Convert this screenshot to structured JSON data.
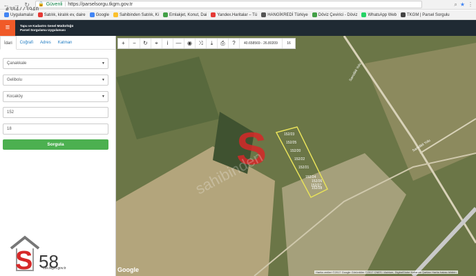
{
  "browser": {
    "secure_label": "Güvenli",
    "url": "https://parselsorgu.tkgm.gov.tr"
  },
  "overlay": {
    "tag": "#384//3940"
  },
  "bookmarks": [
    {
      "label": "Uygulamalar",
      "color": "#4285f4"
    },
    {
      "label": "Satılık, kiralık ev, daire",
      "color": "#e53935"
    },
    {
      "label": "Google",
      "color": "#4285f4"
    },
    {
      "label": "Sahibinden Satılık, Ki",
      "color": "#fbc02d"
    },
    {
      "label": "Emlakjet, Konut, Dai",
      "color": "#43a047"
    },
    {
      "label": "Yandex.Haritalar – Tü",
      "color": "#e53935"
    },
    {
      "label": "HANGİKREDİ Türkiye",
      "color": "#555555"
    },
    {
      "label": "Döviz Çevirici - Döviz",
      "color": "#43a047"
    },
    {
      "label": "WhatsApp Web",
      "color": "#25d366"
    },
    {
      "label": "TKGM | Parsel Sorgulu",
      "color": "#444444"
    }
  ],
  "header": {
    "line1": "Tapu ve Kadastro Genel Müdürlüğü",
    "line2": "Parsel Sorgulama Uygulaması"
  },
  "tabs": [
    "İdari",
    "Coğrafi",
    "Adres",
    "Katman"
  ],
  "form": {
    "il": "Çanakkale",
    "ilce": "Gelibolu",
    "mahalle": "Kocaköy",
    "ada": "152",
    "parsel": "18",
    "submit": "Sorgula"
  },
  "toolbar": {
    "coords": "40.658569 - 26.80209",
    "zoom": "16"
  },
  "map": {
    "brand": "Google",
    "attribution": "Harita verileri ©2017 Google Görüntüler ©2017 CNES / Astrium, DigitalGlobe  Kullanım Şartları  Harita hatası bildirin",
    "watermark": "sahibinden",
    "parcel_labels": [
      "152/23",
      "152/25",
      "152/20",
      "152/22",
      "152/21",
      "152/24",
      "152/26",
      "152/27",
      "152/28"
    ],
    "road_labels": [
      "Samdikli Yolu",
      "Samdikli Yolu"
    ]
  },
  "logo": {
    "number": "58",
    "subtitle": "cbs.tkgm.gov.tr"
  },
  "colors": {
    "appbar": "#1f2a33",
    "menu_accent": "#f05a28",
    "submit": "#4cb050",
    "parcel_outline": "#e8e25a"
  }
}
